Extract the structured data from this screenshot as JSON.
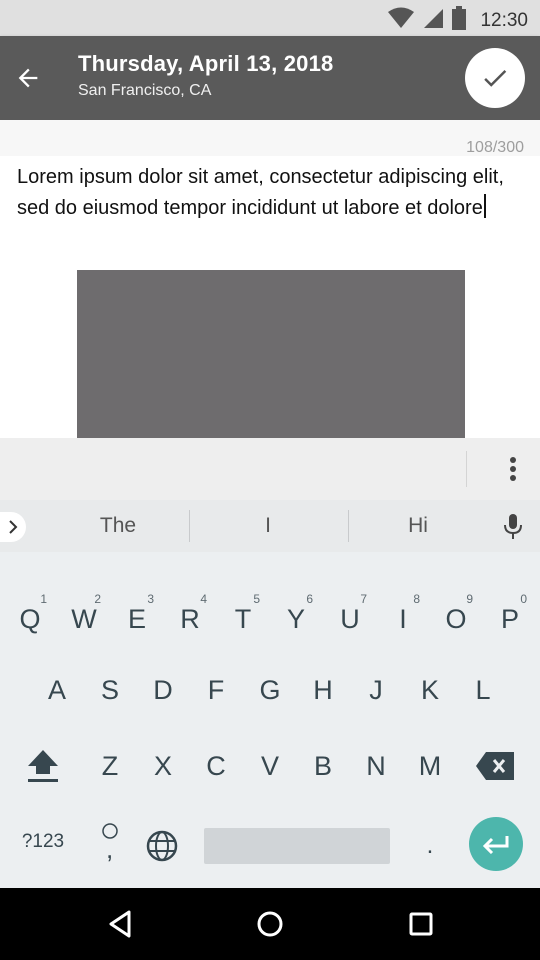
{
  "status_bar": {
    "time": "12:30",
    "icons": [
      "wifi-icon",
      "cellular-signal-icon",
      "battery-icon"
    ]
  },
  "header": {
    "title": "Thursday, April 13, 2018",
    "subtitle": "San Francisco, CA",
    "back_icon": "arrow-back-icon",
    "done_icon": "checkmark-icon"
  },
  "editor": {
    "char_counter": "108/300",
    "body_text": "Lorem ipsum dolor sit amet, consectetur adipiscing elit, sed do eiusmod tempor incididunt ut labore et dolore",
    "image_placeholder_color": "#6e6c6e"
  },
  "toolbar": {
    "overflow_icon": "more-vertical-icon"
  },
  "keyboard": {
    "suggestions": [
      "The",
      "I",
      "Hi"
    ],
    "row1": [
      {
        "key": "Q",
        "hint": "1"
      },
      {
        "key": "W",
        "hint": "2"
      },
      {
        "key": "E",
        "hint": "3"
      },
      {
        "key": "R",
        "hint": "4"
      },
      {
        "key": "T",
        "hint": "5"
      },
      {
        "key": "Y",
        "hint": "6"
      },
      {
        "key": "U",
        "hint": "7"
      },
      {
        "key": "I",
        "hint": "8"
      },
      {
        "key": "O",
        "hint": "9"
      },
      {
        "key": "P",
        "hint": "0"
      }
    ],
    "row2": [
      "A",
      "S",
      "D",
      "F",
      "G",
      "H",
      "J",
      "K",
      "L"
    ],
    "row3": [
      "Z",
      "X",
      "C",
      "V",
      "B",
      "N",
      "M"
    ],
    "symbols_label": "?123",
    "comma_label": ",",
    "period_label": ".",
    "accent_color": "#4db6ac"
  },
  "nav_bar": {
    "buttons": [
      "back-triangle-icon",
      "home-circle-icon",
      "recents-square-icon"
    ]
  }
}
